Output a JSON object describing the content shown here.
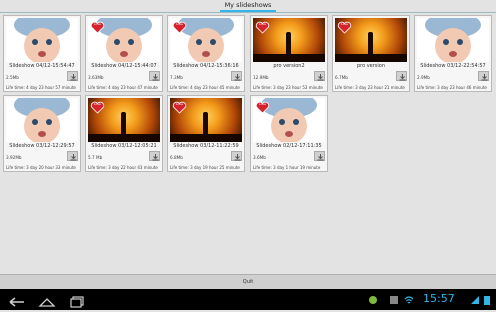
{
  "header": {
    "title": "My slideshows"
  },
  "slideshows": [
    {
      "name": "Slideshow 04/12-15:54:47",
      "size": "2.5Mb",
      "life": "Life time: 4 day 23 hour 57 minute",
      "thumb": "baby",
      "badge": ""
    },
    {
      "name": "Slideshow 04/12-15:44:07",
      "size": "3.63Mb",
      "life": "Life time: 4 day 23 hour 47 minute",
      "thumb": "baby",
      "badge": "heart"
    },
    {
      "name": "Slideshow 04/12-15:36:16",
      "size": "7.3Mb",
      "life": "Life time: 4 day 23 hour 45 minute",
      "thumb": "baby",
      "badge": "heart"
    },
    {
      "name": "pro version2",
      "size": "12.9Mb",
      "life": "Life time: 3 day 23 hour 53 minute",
      "thumb": "sunset",
      "badge": "heart"
    },
    {
      "name": "pro version",
      "size": "6.7Mb",
      "life": "Life time: 3 day 23 hour 21 minute",
      "thumb": "sunset",
      "badge": "heart"
    },
    {
      "name": "Slideshow 03/12-22:54:57",
      "size": "2.9Mb",
      "life": "Life time: 3 day 23 hour 46 minute",
      "thumb": "baby",
      "badge": ""
    },
    {
      "name": "Slideshow 03/12-12:29:57",
      "size": "3.92Mb",
      "life": "Life time: 3 day 20 hour 33 minute",
      "thumb": "baby",
      "badge": ""
    },
    {
      "name": "Slideshow 03/12-12:05:21",
      "size": "5.7 Mb",
      "life": "Life time: 3 day 22 hour 43 minute",
      "thumb": "sunset",
      "badge": "heart"
    },
    {
      "name": "Slideshow 03/12-11:22:59",
      "size": "6.8Mb",
      "life": "Life time: 3 day 19 hour 25 minute",
      "thumb": "sunset",
      "badge": "heart"
    },
    {
      "name": "Slideshow 02/12-17:11:35",
      "size": "3.6Mb",
      "life": "Life time: 3 day 1 hour 19 minute",
      "thumb": "baby",
      "badge": "heart"
    }
  ],
  "heart_label": "Love",
  "footer": {
    "quit_label": "Quit"
  },
  "statusbar": {
    "time": "15:57"
  },
  "colors": {
    "accent": "#33b5e5",
    "heart": "#d5232d"
  },
  "icons": {
    "download": "download-icon",
    "back": "back-icon",
    "home": "home-icon",
    "recent": "recent-apps-icon"
  }
}
